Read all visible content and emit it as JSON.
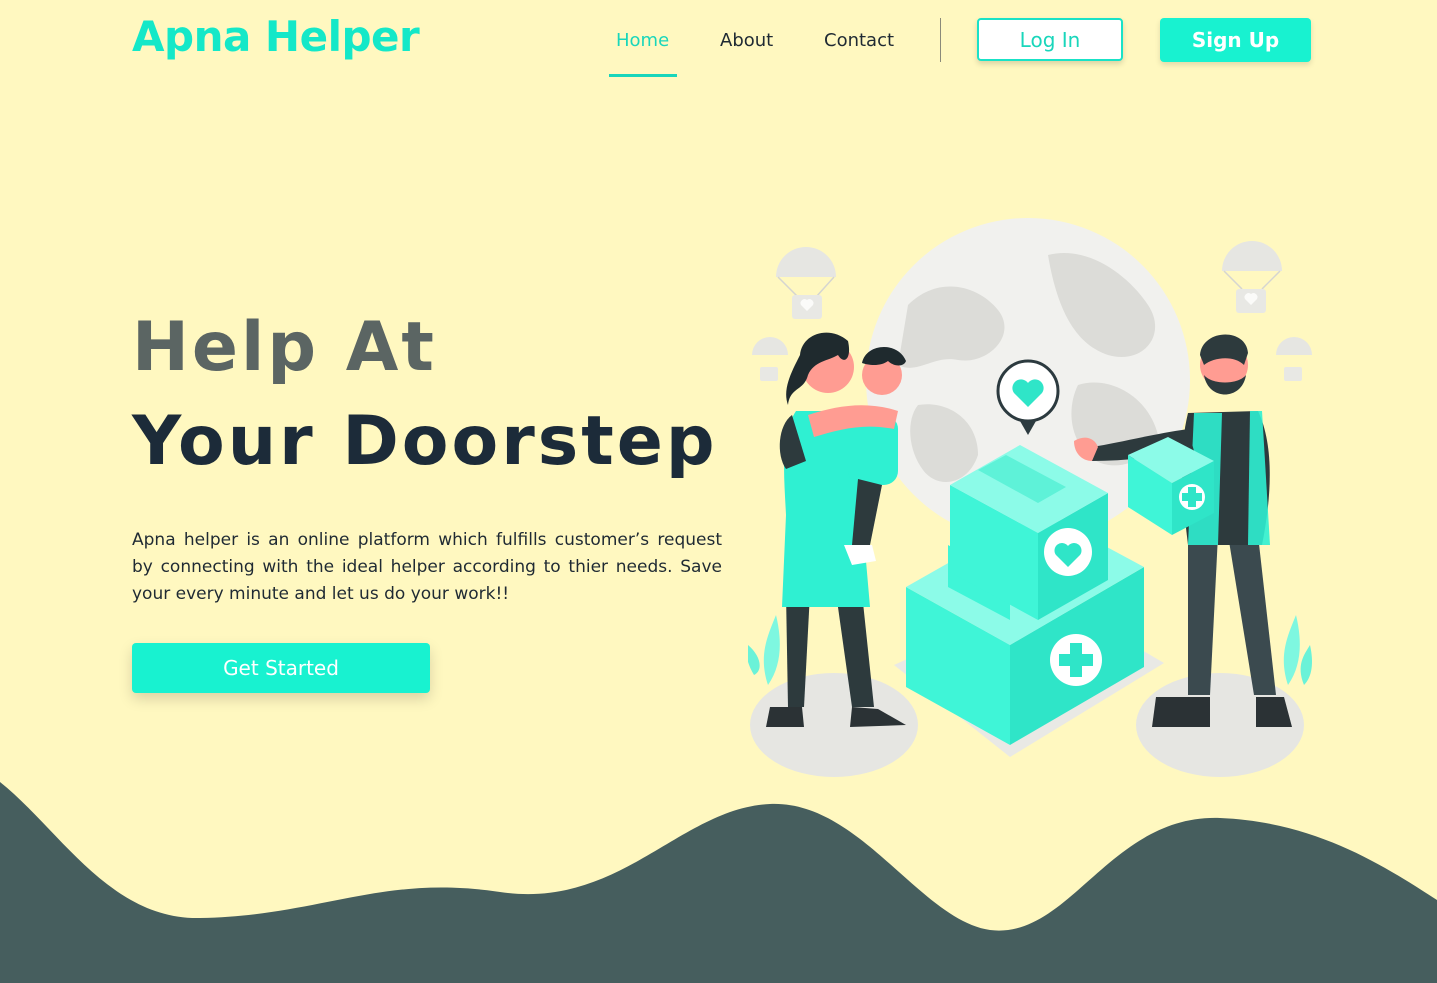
{
  "header": {
    "logo": "Apna Helper",
    "nav": {
      "home": "Home",
      "about": "About",
      "contact": "Contact"
    },
    "login_label": "Log In",
    "signup_label": "Sign Up"
  },
  "hero": {
    "title_line1": "Help At",
    "title_line2": "Your Doorstep",
    "description": "Apna helper is an online platform which fulfills customer’s request by connecting with the ideal helper according to thier needs. Save your every minute and let us do your work!!",
    "cta_label": "Get Started"
  },
  "illustration": {
    "icon": "delivery-helper-illustration"
  },
  "colors": {
    "accent": "#18f2d0",
    "background": "#fff8c0",
    "wave": "#465e5e",
    "heading_dark": "#1c2b39",
    "heading_gray": "#5b6563"
  }
}
